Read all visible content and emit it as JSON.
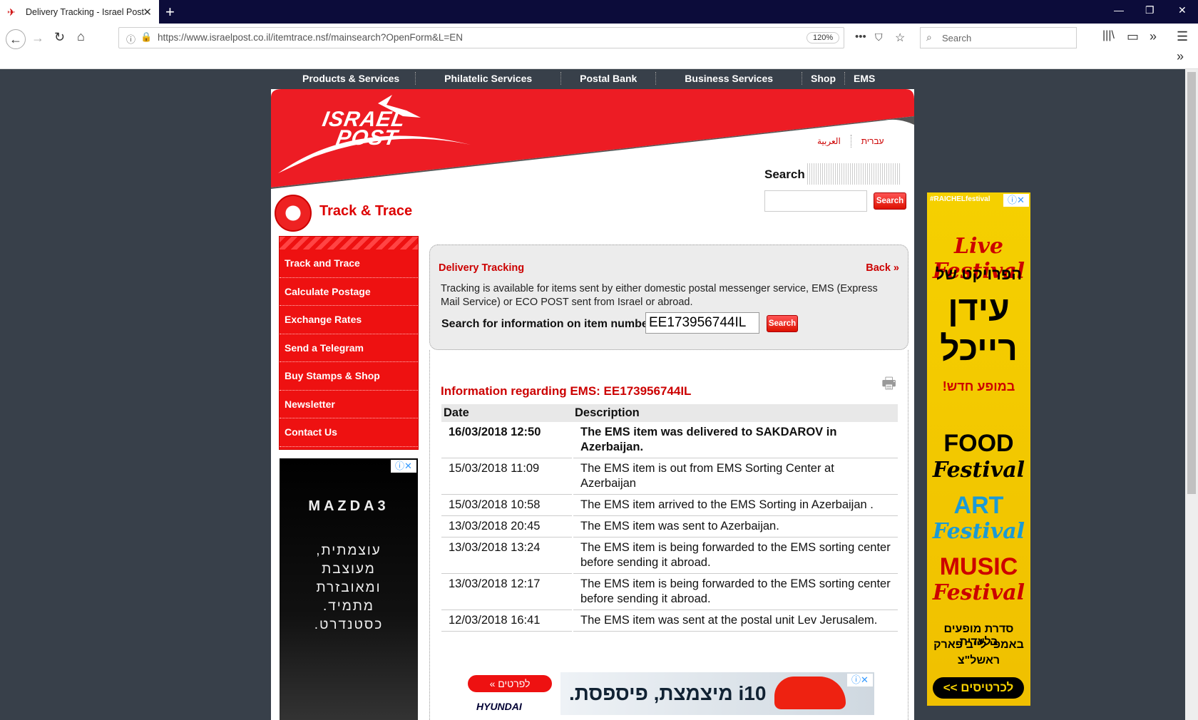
{
  "browser": {
    "tab_title": "Delivery Tracking - Israel Post",
    "url_host": "https://www.israelpost.co.il",
    "url_path": "/itemtrace.nsf/mainsearch?OpenForm&L=EN",
    "zoom": "120%",
    "search_placeholder": "Search"
  },
  "topmenu": [
    "Products & Services",
    "Philatelic Services",
    "Postal Bank",
    "Business Services",
    "Shop",
    "EMS"
  ],
  "header": {
    "logo_line1": "ISRAEL",
    "logo_line2": "POST",
    "lang_arabic": "العربية",
    "lang_hebrew": "עברית",
    "search_label": "Search",
    "search_button": "Search"
  },
  "section_title": "Track & Trace",
  "sidenav": [
    "Track and Trace",
    "Calculate Postage",
    "Exchange Rates",
    "Send a Telegram",
    "Buy Stamps & Shop",
    "Newsletter",
    "Contact Us"
  ],
  "ad_left": {
    "brand": "MAZDA3",
    "copy": [
      "עוצמתית,",
      "מעוצבת",
      "ומאובזרת",
      "מתמיד.",
      "כסטנדרט."
    ]
  },
  "panel": {
    "title": "Delivery Tracking",
    "back": "Back »",
    "description": "Tracking is available for items sent by either domestic postal messenger service, EMS (Express Mail Service) or ECO POST sent from Israel or abroad.",
    "search_label": "Search for information on item number:",
    "item_number": "EE173956744IL",
    "search_button": "Search"
  },
  "results": {
    "title": "Information regarding EMS: EE173956744IL",
    "col_date": "Date",
    "col_desc": "Description",
    "rows": [
      {
        "date": "16/03/2018 12:50",
        "desc": "The EMS item was delivered to SAKDAROV in Azerbaijan."
      },
      {
        "date": "15/03/2018 11:09",
        "desc": "The EMS item is out from EMS Sorting Center at Azerbaijan"
      },
      {
        "date": "15/03/2018 10:58",
        "desc": "The EMS item arrived to the EMS Sorting in Azerbaijan ."
      },
      {
        "date": "13/03/2018 20:45",
        "desc": "The EMS item was sent to Azerbaijan."
      },
      {
        "date": "13/03/2018 13:24",
        "desc": "The EMS item is being forwarded to the EMS sorting center before sending it abroad."
      },
      {
        "date": "13/03/2018 12:17",
        "desc": "The EMS item is being forwarded to the EMS sorting center before sending it abroad."
      },
      {
        "date": "12/03/2018 16:41",
        "desc": "The EMS item was sent at the postal unit Lev Jerusalem."
      }
    ]
  },
  "ad_bottom": {
    "button": "לפרטים »",
    "brand": "HYUNDAI",
    "headline": "i10 מיצמצת, פיספסת."
  },
  "ad_right": {
    "tag": "#RAICHELfestival",
    "line1": "Live Festival",
    "line2": "הפרויקט של",
    "line3": "עידן",
    "line4": "רייכל",
    "line5": "במופע חדש!",
    "line6": "FOOD",
    "line7": "Festival",
    "line8": "ART",
    "line9": "Festival",
    "line10": "MUSIC",
    "line11": "Festival",
    "line12": "סדרת מופעים בלעדית",
    "line13": "באמפי לייב פארק",
    "line14": "ראשל\"צ",
    "cta": "לכרטיסים >>"
  }
}
